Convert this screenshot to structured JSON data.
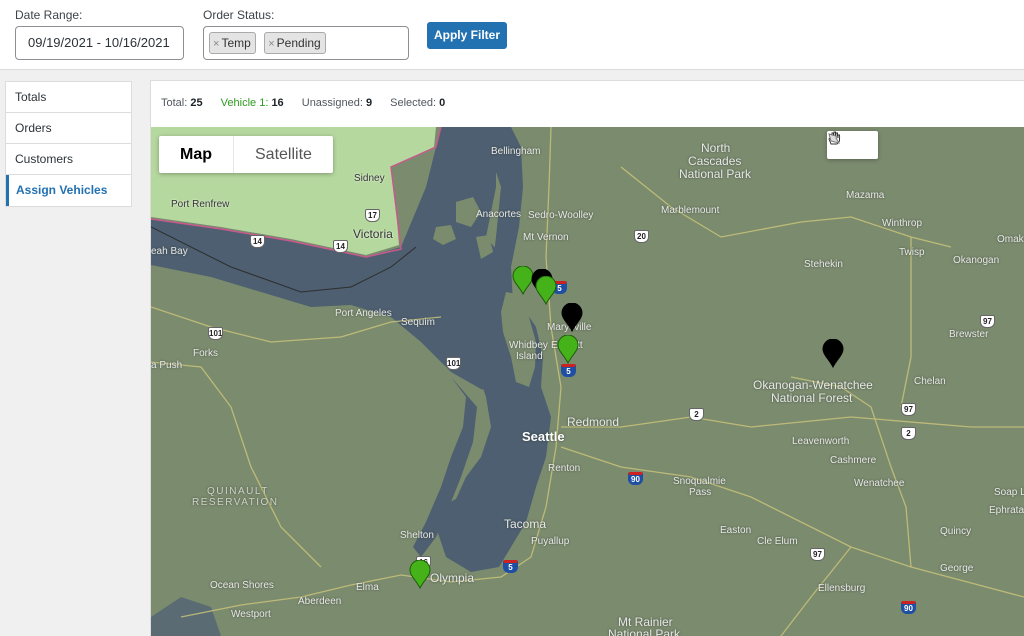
{
  "filters": {
    "date_range_label": "Date Range:",
    "date_range_value": "09/19/2021 - 10/16/2021",
    "order_status_label": "Order Status:",
    "order_status_chips": [
      "Temp",
      "Pending"
    ],
    "chip_remove_glyph": "×",
    "apply_label": "Apply Filter"
  },
  "sidebar": {
    "items": [
      {
        "label": "Totals"
      },
      {
        "label": "Orders"
      },
      {
        "label": "Customers"
      },
      {
        "label": "Assign Vehicles",
        "active": true
      }
    ]
  },
  "stats": {
    "total_label": "Total:",
    "total_value": "25",
    "vehicle_label": "Vehicle 1:",
    "vehicle_value": "16",
    "unassigned_label": "Unassigned:",
    "unassigned_value": "9",
    "selected_label": "Selected:",
    "selected_value": "0"
  },
  "map": {
    "map_type_buttons": [
      "Map",
      "Satellite"
    ],
    "selected_type": "Map",
    "draw_tools": [
      "hand-icon",
      "polygon-icon"
    ],
    "places": {
      "bellingham": "Bellingham",
      "north_cascades_1": "North",
      "north_cascades_2": "Cascades",
      "north_cascades_3": "National Park",
      "sidney": "Sidney",
      "port_renfrew": "Port Renfrew",
      "victoria": "Victoria",
      "anacortes": "Anacortes",
      "sedro_woolley": "Sedro-Woolley",
      "marblemount": "Marblemount",
      "mazama": "Mazama",
      "winthrop": "Winthrop",
      "twisp": "Twisp",
      "omak": "Omak",
      "okanogan": "Okanogan",
      "stehekin": "Stehekin",
      "mt_vernon": "Mt Vernon",
      "neah_bay": "eah Bay",
      "port_angeles": "Port Angeles",
      "sequim": "Sequim",
      "marysville": "Marysville",
      "whidbey_1": "Whidbey",
      "whidbey_2": "Island",
      "everett": "Everett",
      "brewster": "Brewster",
      "forks": "Forks",
      "la_push": "a Push",
      "okanogan_nf_1": "Okanogan-Wenatchee",
      "okanogan_nf_2": "National Forest",
      "chelan": "Chelan",
      "redmond": "Redmond",
      "seattle": "Seattle",
      "leavenworth": "Leavenworth",
      "cashmere": "Cashmere",
      "renton": "Renton",
      "wenatchee": "Wenatchee",
      "snoqualmie_1": "Snoqualmie",
      "snoqualmie_2": "Pass",
      "soap_lake": "Soap L",
      "ephrata": "Ephrata",
      "quinault_1": "QUINAULT",
      "quinault_2": "RESERVATION",
      "tacoma": "Tacoma",
      "puyallup": "Puyallup",
      "easton": "Easton",
      "cle_elum": "Cle Elum",
      "quincy": "Quincy",
      "shelton": "Shelton",
      "ocean_shores": "Ocean Shores",
      "olympia": "Olympia",
      "elma": "Elma",
      "aberdeen": "Aberdeen",
      "george": "George",
      "ellensburg": "Ellensburg",
      "westport": "Westport",
      "mt_rainier_1": "Mt Rainier",
      "mt_rainier_2": "National Park"
    },
    "shields": {
      "s17": "17",
      "s14a": "14",
      "s14b": "14",
      "s20": "20",
      "s5a": "5",
      "s5b": "5",
      "s5c": "5",
      "s101a": "101",
      "s101b": "101",
      "s97a": "97",
      "s97b": "97",
      "s97c": "97",
      "s2a": "2",
      "s2b": "2",
      "s90a": "90",
      "s90b": "90",
      "s16": "16"
    },
    "colors": {
      "assigned_marker": "#45b21a",
      "unassigned_marker": "#000000",
      "water": "#4d5f70",
      "land": "#7b8b6e",
      "canada": "#b5d89e"
    },
    "markers": [
      {
        "name": "marker-assigned",
        "status": "Vehicle 1"
      },
      {
        "name": "marker-assigned",
        "status": "Vehicle 1"
      },
      {
        "name": "marker-assigned",
        "status": "Vehicle 1"
      },
      {
        "name": "marker-assigned",
        "status": "Vehicle 1"
      },
      {
        "name": "marker-assigned",
        "status": "Vehicle 1"
      },
      {
        "name": "marker-unassigned",
        "status": "Unassigned"
      },
      {
        "name": "marker-unassigned",
        "status": "Unassigned"
      },
      {
        "name": "marker-unassigned",
        "status": "Unassigned"
      }
    ]
  }
}
